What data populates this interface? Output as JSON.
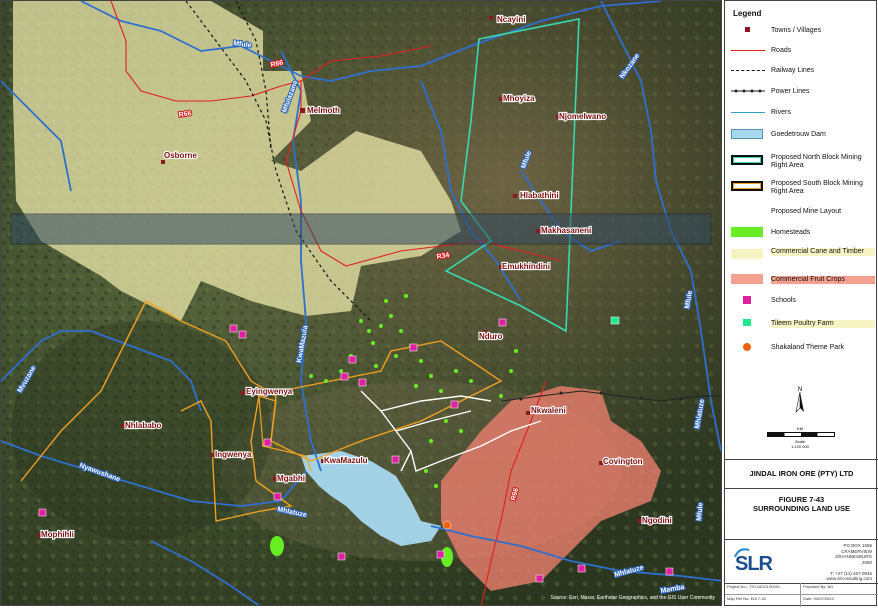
{
  "legend": {
    "title": "Legend",
    "items": [
      {
        "label": "Towns / Villages",
        "kind": "town"
      },
      {
        "label": "Roads",
        "kind": "road"
      },
      {
        "label": "Railway Lines",
        "kind": "rail"
      },
      {
        "label": "Power Lines",
        "kind": "power"
      },
      {
        "label": "Rivers",
        "kind": "river"
      },
      {
        "label": "Goedetrouw Dam",
        "kind": "dam"
      },
      {
        "label": "Proposed North Block Mining Right Area",
        "kind": "north-block"
      },
      {
        "label": "Proposed South Block Mining Right Area",
        "kind": "south-block"
      },
      {
        "label": "Proposed Mine Layout",
        "kind": "mine-layout"
      },
      {
        "label": "Homesteads",
        "kind": "homesteads"
      },
      {
        "label": "Commercial Cane and Timber",
        "kind": "cane"
      },
      {
        "label": "Commercial Fruit Crops",
        "kind": "fruit"
      },
      {
        "label": "Schools",
        "kind": "school"
      },
      {
        "label": "Tileem Poultry Farm",
        "kind": "poultry"
      },
      {
        "label": "Shakaland Theme Park",
        "kind": "shakaland"
      }
    ]
  },
  "colors": {
    "town": "#8b1a1a",
    "road": "#e02020",
    "river": "#2f6fd0",
    "dam": "#a8d8f0",
    "north_block": "#38d8b0",
    "south_block": "#f0a020",
    "homesteads": "#66ee22",
    "cane": "#f2efb0",
    "fruit": "#f08070",
    "school": "#e020a0",
    "poultry": "#20e890",
    "shakaland": "#f06010",
    "mine_layout": "#ffffff",
    "satellite_dark": "#3b4a2e"
  },
  "towns": [
    {
      "name": "Ncayini"
    },
    {
      "name": "Melmoth"
    },
    {
      "name": "Mhoyiza"
    },
    {
      "name": "Njomelwano"
    },
    {
      "name": "Osborne"
    },
    {
      "name": "Hlabathini"
    },
    {
      "name": "Makhasaneni"
    },
    {
      "name": "Emukhindini"
    },
    {
      "name": "Nduro"
    },
    {
      "name": "Eyingwenya"
    },
    {
      "name": "Nhlababo"
    },
    {
      "name": "Nkwaleni"
    },
    {
      "name": "Ingwenya"
    },
    {
      "name": "KwaMazulu"
    },
    {
      "name": "Mgabhi"
    },
    {
      "name": "Covington"
    },
    {
      "name": "Ngodini"
    },
    {
      "name": "Mophihli"
    }
  ],
  "rivers": [
    {
      "name": "Mfule"
    },
    {
      "name": "Mfulazane"
    },
    {
      "name": "Nkozane"
    },
    {
      "name": "Mfule"
    },
    {
      "name": "KwaMazula"
    },
    {
      "name": "Mvuzane"
    },
    {
      "name": "Mhlatuze"
    },
    {
      "name": "Nyawushane"
    },
    {
      "name": "Mfule"
    },
    {
      "name": "Mhlatuze"
    },
    {
      "name": "Mfule"
    },
    {
      "name": "Mhlatuze"
    },
    {
      "name": "Mamba"
    }
  ],
  "roads": [
    {
      "name": "R66"
    },
    {
      "name": "R66"
    },
    {
      "name": "R34"
    },
    {
      "name": "R66"
    }
  ],
  "attribution": "Source: Esri, Maxar, Earthstar Geographics, and the GIS User Community",
  "scale": {
    "label": "Scale",
    "ratio": "1:120 000",
    "unit": "KM"
  },
  "north_label": "N",
  "company": "JINDAL IRON ORE (PTY) LTD",
  "figure": {
    "number": "FIGURE 7-43",
    "title": "SURROUNDING LAND USE"
  },
  "logo": "SLR",
  "address": [
    "PO BOX 1596",
    "CRAMERVIEW",
    "JOHANNESBURG",
    "2060",
    "",
    "T: +27 (11) 467-0945",
    "www.slrconsulting.com"
  ],
  "meta": {
    "project": "Project No.: 720.16023.00001",
    "prepared": "Prepared By: BG",
    "ref": "Map Ref No: EIA 7-43",
    "date": "Date: 04/07/2023"
  }
}
